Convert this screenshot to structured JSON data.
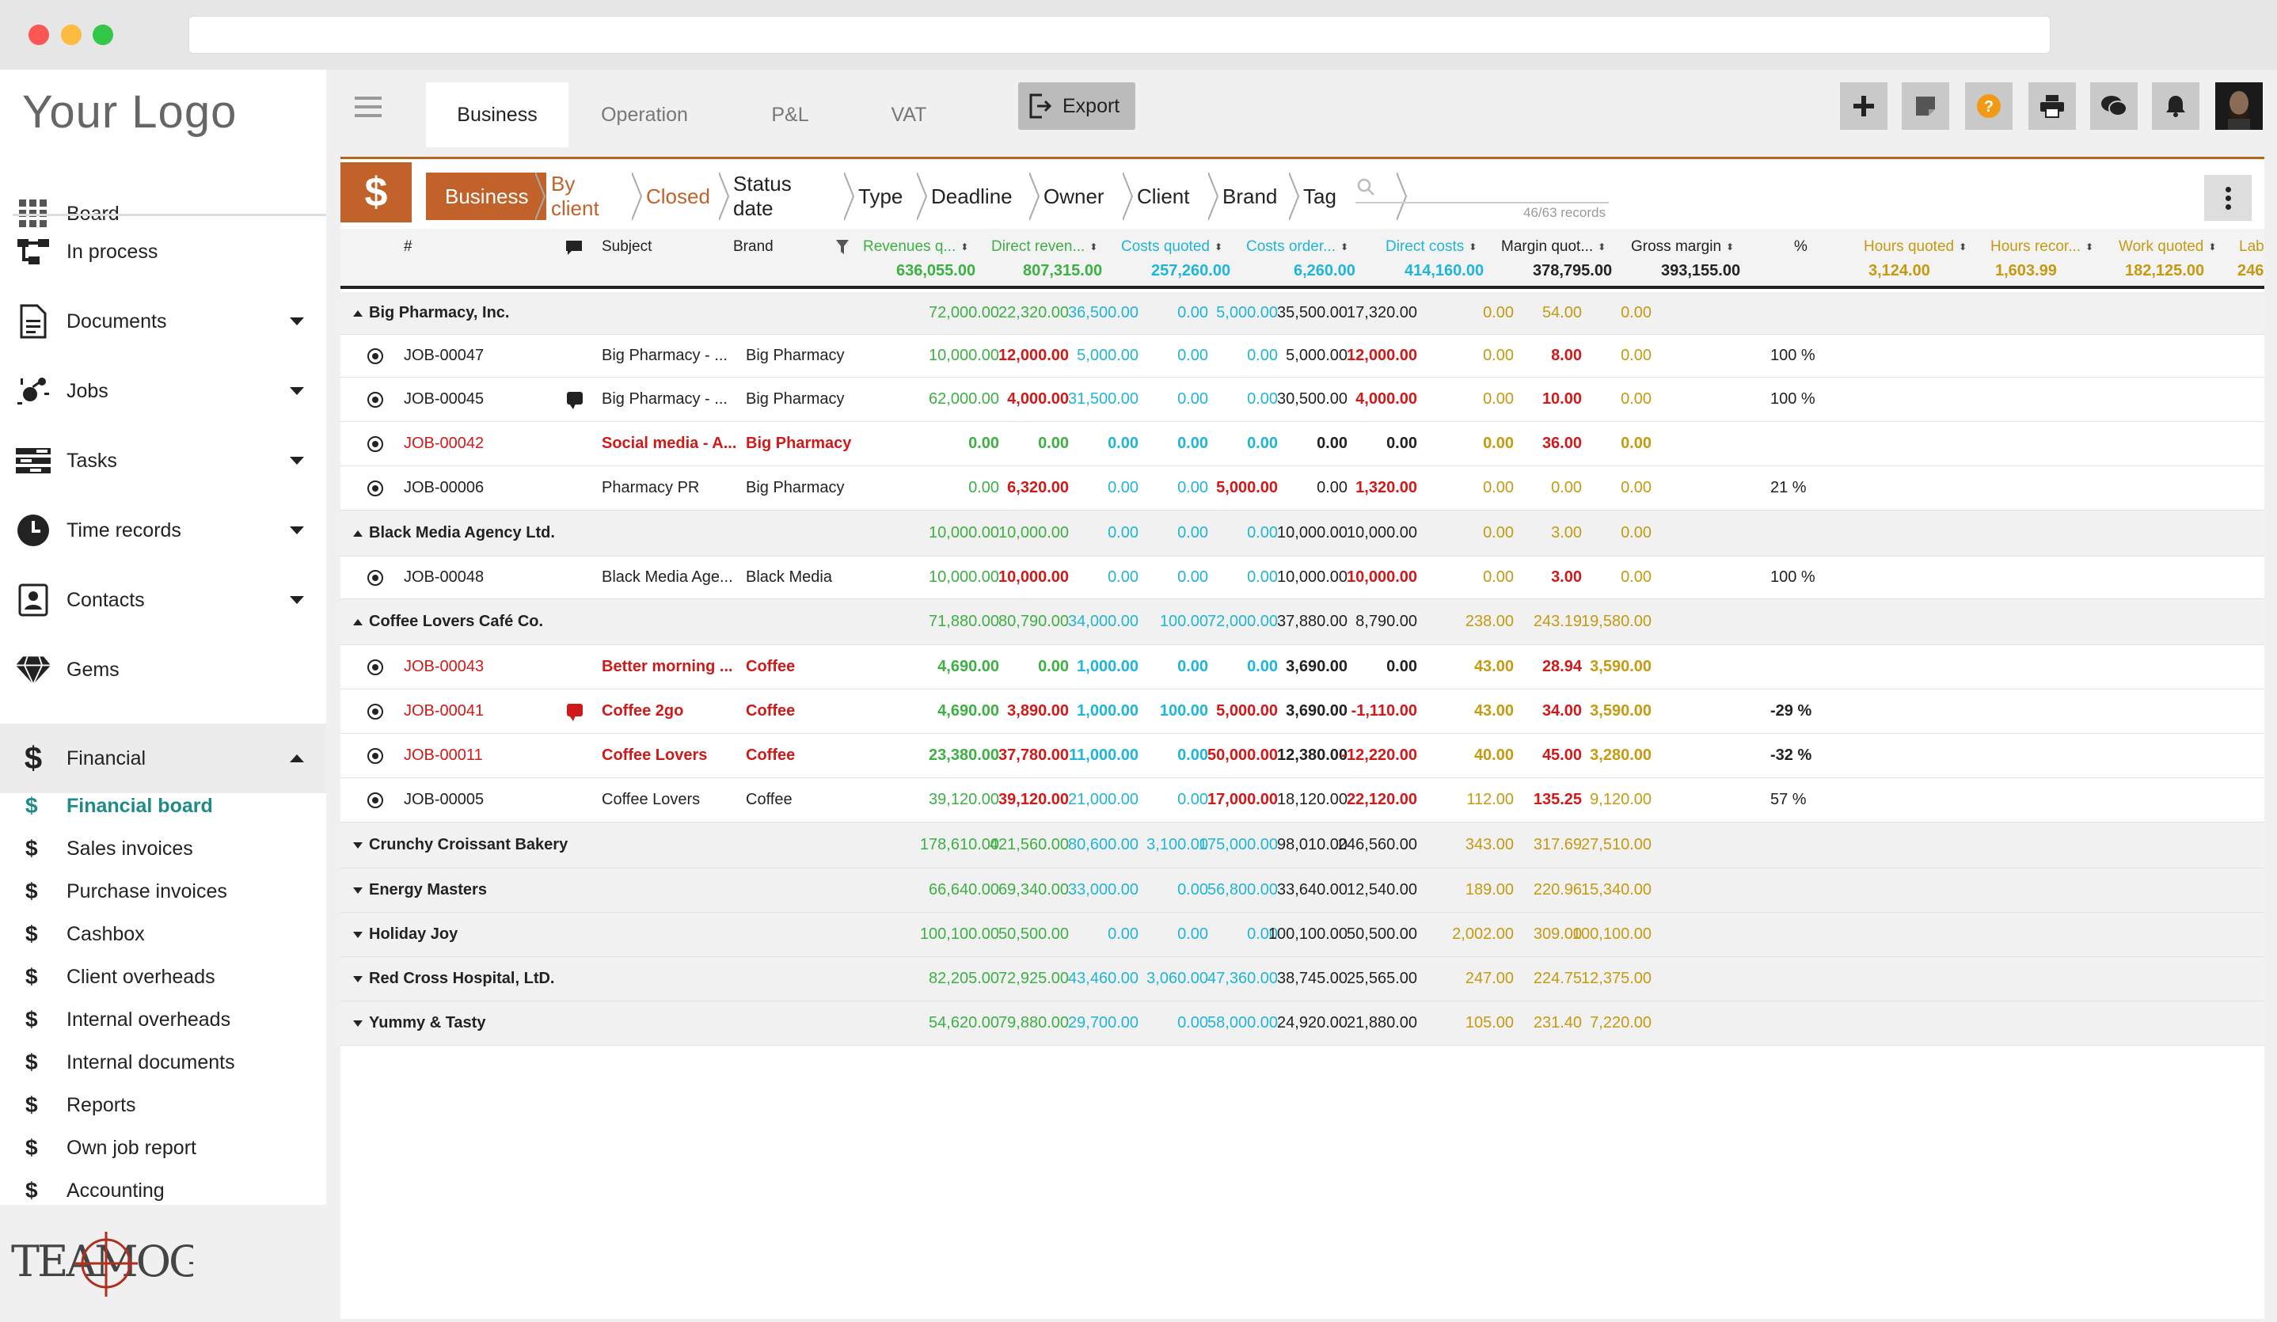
{
  "sidebar": {
    "logo": "Your Logo",
    "items": [
      {
        "label": "Board",
        "icon": "grid-icon"
      },
      {
        "label": "In process",
        "icon": "flow-icon"
      },
      {
        "label": "Documents",
        "icon": "document-icon"
      },
      {
        "label": "Jobs",
        "icon": "jobs-icon"
      },
      {
        "label": "Tasks",
        "icon": "tasks-icon"
      },
      {
        "label": "Time records",
        "icon": "clock-icon"
      },
      {
        "label": "Contacts",
        "icon": "contacts-icon"
      },
      {
        "label": "Gems",
        "icon": "gem-icon"
      },
      {
        "label": "Financial",
        "icon": "dollar-icon"
      }
    ],
    "financial_sub": [
      "Financial board",
      "Sales invoices",
      "Purchase invoices",
      "Cashbox",
      "Client overheads",
      "Internal overheads",
      "Internal documents",
      "Reports",
      "Own job report",
      "Accounting"
    ],
    "brand": "TEAMOGY"
  },
  "topbar": {
    "tabs": [
      "Business",
      "Operation",
      "P&L",
      "VAT"
    ],
    "export_label": "Export"
  },
  "filters": {
    "crumbs": [
      "Business",
      "By client",
      "Closed",
      "Status date",
      "Type",
      "Deadline",
      "Owner",
      "Client",
      "Brand",
      "Tag"
    ],
    "records": "46/63 records"
  },
  "columns": {
    "hash": "#",
    "subject": "Subject",
    "brand": "Brand",
    "revenues": "Revenues q...",
    "direct_rev": "Direct reven...",
    "costs_quoted": "Costs quoted",
    "costs_order": "Costs order...",
    "direct_costs": "Direct costs",
    "margin_quot": "Margin quot...",
    "gross_margin": "Gross margin",
    "pct": "%",
    "hours_quoted": "Hours quoted",
    "hours_recor": "Hours recor...",
    "work_quoted": "Work quoted",
    "labor": "Labor c"
  },
  "totals": {
    "revenues": "636,055.00",
    "direct_rev": "807,315.00",
    "costs_quoted": "257,260.00",
    "costs_order": "6,260.00",
    "direct_costs": "414,160.00",
    "margin_quot": "378,795.00",
    "gross_margin": "393,155.00",
    "hours_quoted": "3,124.00",
    "hours_recor": "1,603.99",
    "work_quoted": "182,125.00",
    "labor": "246"
  },
  "rows": [
    {
      "kind": "group",
      "expanded": true,
      "name": "Big Pharmacy, Inc.",
      "v": [
        "72,000.00",
        "22,320.00",
        "36,500.00",
        "0.00",
        "5,000.00",
        "35,500.00",
        "17,320.00",
        "",
        "0.00",
        "54.00",
        "0.00"
      ]
    },
    {
      "kind": "item",
      "id": "JOB-00047",
      "comment": false,
      "subject": "Big Pharmacy - ...",
      "brand": "Big Pharmacy",
      "v": [
        "10,000.00",
        "12,000.00",
        "5,000.00",
        "0.00",
        "0.00",
        "5,000.00",
        "12,000.00",
        "100 %",
        "0.00",
        "8.00",
        "0.00"
      ]
    },
    {
      "kind": "item",
      "id": "JOB-00045",
      "comment": true,
      "subject": "Big Pharmacy - ...",
      "brand": "Big Pharmacy",
      "v": [
        "62,000.00",
        "4,000.00",
        "31,500.00",
        "0.00",
        "0.00",
        "30,500.00",
        "4,000.00",
        "100 %",
        "0.00",
        "10.00",
        "0.00"
      ]
    },
    {
      "kind": "item",
      "id": "JOB-00042",
      "red": true,
      "comment": false,
      "subject": "Social media - A...",
      "brand": "Big Pharmacy",
      "v": [
        "0.00",
        "0.00",
        "0.00",
        "0.00",
        "0.00",
        "0.00",
        "0.00",
        "",
        "0.00",
        "36.00",
        "0.00"
      ]
    },
    {
      "kind": "item",
      "id": "JOB-00006",
      "comment": false,
      "subject": "Pharmacy PR",
      "brand": "Big Pharmacy",
      "v": [
        "0.00",
        "6,320.00",
        "0.00",
        "0.00",
        "5,000.00",
        "0.00",
        "1,320.00",
        "21 %",
        "0.00",
        "0.00",
        "0.00"
      ]
    },
    {
      "kind": "group",
      "expanded": true,
      "name": "Black Media Agency Ltd.",
      "v": [
        "10,000.00",
        "10,000.00",
        "0.00",
        "0.00",
        "0.00",
        "10,000.00",
        "10,000.00",
        "",
        "0.00",
        "3.00",
        "0.00"
      ]
    },
    {
      "kind": "item",
      "id": "JOB-00048",
      "comment": false,
      "subject": "Black Media Age...",
      "brand": "Black Media",
      "v": [
        "10,000.00",
        "10,000.00",
        "0.00",
        "0.00",
        "0.00",
        "10,000.00",
        "10,000.00",
        "100 %",
        "0.00",
        "3.00",
        "0.00"
      ]
    },
    {
      "kind": "group",
      "expanded": true,
      "name": "Coffee Lovers Café Co.",
      "v": [
        "71,880.00",
        "80,790.00",
        "34,000.00",
        "100.00",
        "72,000.00",
        "37,880.00",
        "8,790.00",
        "",
        "238.00",
        "243.19",
        "19,580.00"
      ]
    },
    {
      "kind": "item",
      "id": "JOB-00043",
      "red": true,
      "comment": false,
      "subject": "Better morning ...",
      "brand": "Coffee",
      "v": [
        "4,690.00",
        "0.00",
        "1,000.00",
        "0.00",
        "0.00",
        "3,690.00",
        "0.00",
        "",
        "43.00",
        "28.94",
        "3,590.00"
      ]
    },
    {
      "kind": "item",
      "id": "JOB-00041",
      "red": true,
      "comment": true,
      "subject": "Coffee 2go",
      "brand": "Coffee",
      "v": [
        "4,690.00",
        "3,890.00",
        "1,000.00",
        "100.00",
        "5,000.00",
        "3,690.00",
        "-1,110.00",
        "-29 %",
        "43.00",
        "34.00",
        "3,590.00"
      ]
    },
    {
      "kind": "item",
      "id": "JOB-00011",
      "red": true,
      "comment": false,
      "subject": "Coffee Lovers",
      "brand": "Coffee",
      "v": [
        "23,380.00",
        "37,780.00",
        "11,000.00",
        "0.00",
        "50,000.00",
        "12,380.00",
        "-12,220.00",
        "-32 %",
        "40.00",
        "45.00",
        "3,280.00"
      ]
    },
    {
      "kind": "item",
      "id": "JOB-00005",
      "comment": false,
      "subject": "Coffee Lovers",
      "brand": "Coffee",
      "v": [
        "39,120.00",
        "39,120.00",
        "21,000.00",
        "0.00",
        "17,000.00",
        "18,120.00",
        "22,120.00",
        "57 %",
        "112.00",
        "135.25",
        "9,120.00"
      ]
    },
    {
      "kind": "group",
      "expanded": false,
      "name": "Crunchy Croissant Bakery",
      "v": [
        "178,610.00",
        "421,560.00",
        "80,600.00",
        "3,100.00",
        "175,000.00",
        "98,010.00",
        "246,560.00",
        "",
        "343.00",
        "317.69",
        "27,510.00"
      ]
    },
    {
      "kind": "group",
      "expanded": false,
      "name": "Energy Masters",
      "v": [
        "66,640.00",
        "69,340.00",
        "33,000.00",
        "0.00",
        "56,800.00",
        "33,640.00",
        "12,540.00",
        "",
        "189.00",
        "220.96",
        "15,340.00"
      ]
    },
    {
      "kind": "group",
      "expanded": false,
      "name": "Holiday Joy",
      "v": [
        "100,100.00",
        "50,500.00",
        "0.00",
        "0.00",
        "0.00",
        "100,100.00",
        "50,500.00",
        "",
        "2,002.00",
        "309.00",
        "100,100.00"
      ]
    },
    {
      "kind": "group",
      "expanded": false,
      "name": "Red Cross Hospital, LtD.",
      "v": [
        "82,205.00",
        "72,925.00",
        "43,460.00",
        "3,060.00",
        "47,360.00",
        "38,745.00",
        "25,565.00",
        "",
        "247.00",
        "224.75",
        "12,375.00"
      ]
    },
    {
      "kind": "group",
      "expanded": false,
      "name": "Yummy & Tasty",
      "v": [
        "54,620.00",
        "79,880.00",
        "29,700.00",
        "0.00",
        "58,000.00",
        "24,920.00",
        "21,880.00",
        "",
        "105.00",
        "231.40",
        "7,220.00"
      ]
    }
  ],
  "colors": {
    "accent": "#c0622a",
    "revenue": "#3cb043",
    "cost": "#1fb5d8",
    "hours": "#c59a10",
    "alert": "#d01919",
    "active_nav": "#1f8a8a"
  }
}
